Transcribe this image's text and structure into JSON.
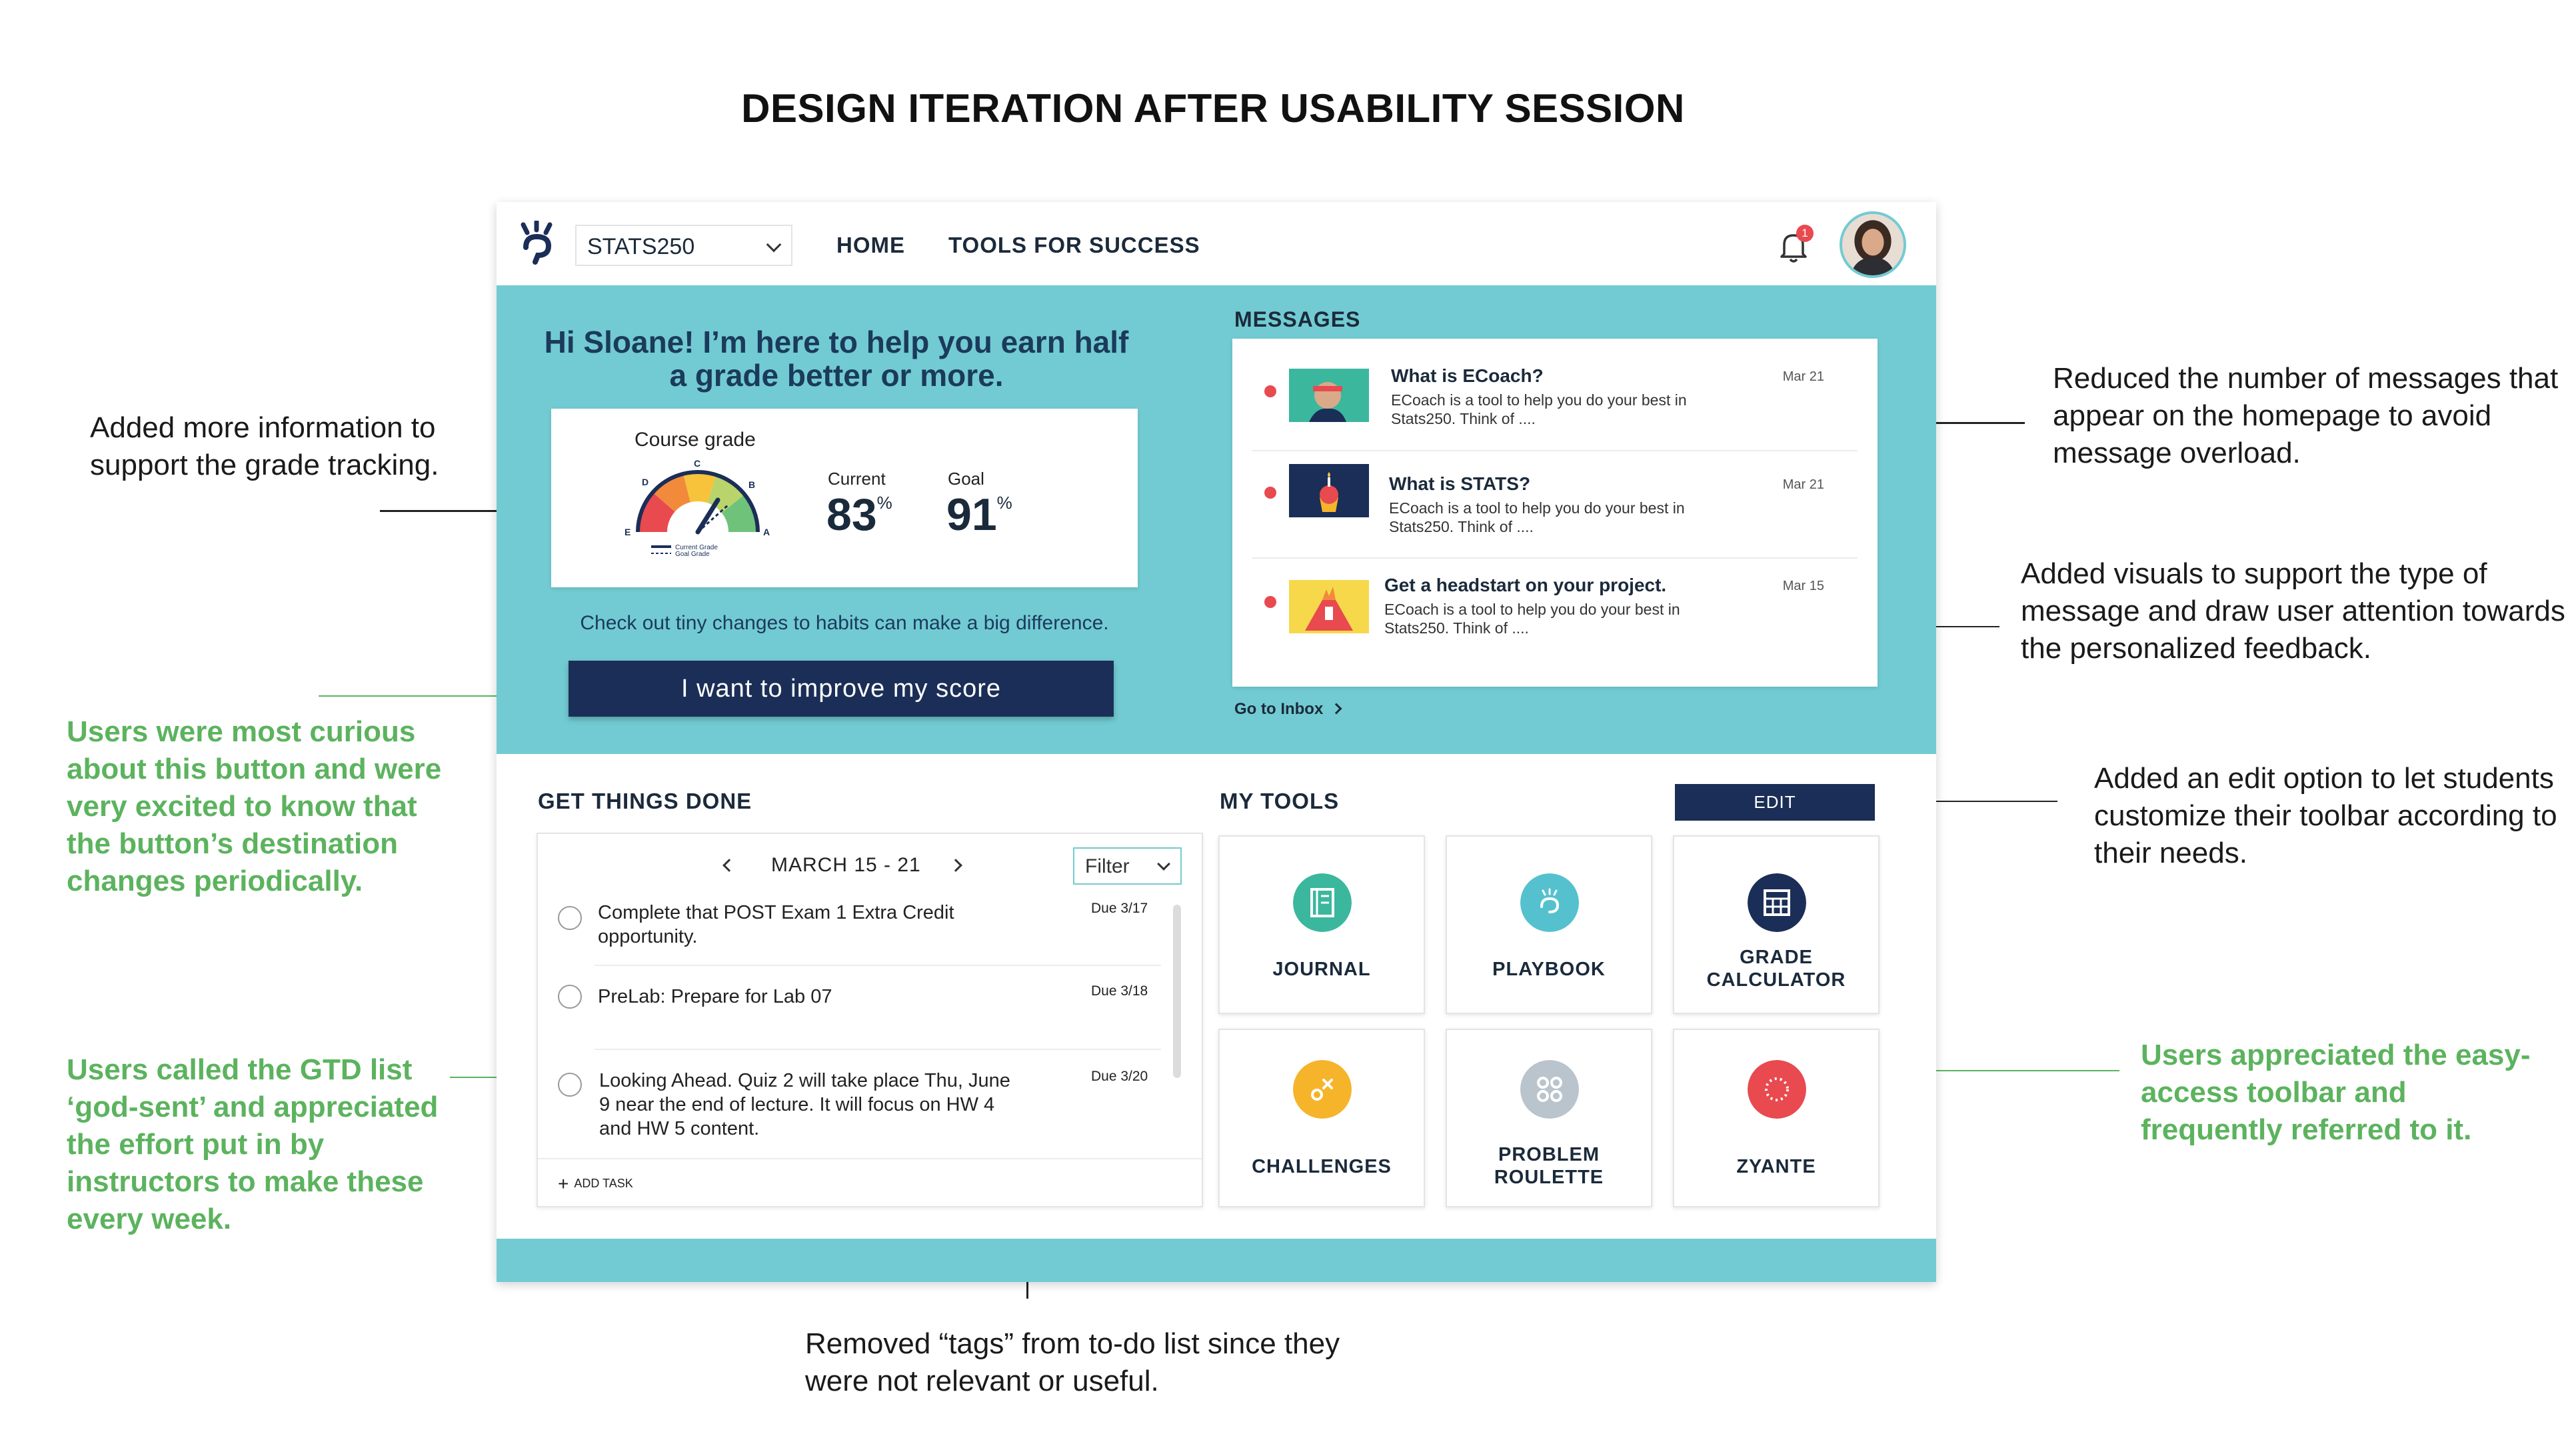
{
  "page_title": "DESIGN ITERATION AFTER USABILITY SESSION",
  "annotations": {
    "grade_tracking": "Added more information to support the grade tracking.",
    "button_curious": "Users were most curious about this button and were very excited to know that the button’s destination changes periodically.",
    "gtd_godsent": "Users called the GTD list ‘god-sent’ and appreciated the effort put in by instructors to make these every week.",
    "removed_tags": "Removed “tags” from to-do list since they were not relevant or useful.",
    "reduced_messages": "Reduced the number of messages that appear on the homepage to avoid message overload.",
    "added_visuals": "Added visuals to support the type of message and draw user attention towards the personalized feedback.",
    "edit_option": "Added an edit option to let students customize their toolbar according to their needs.",
    "toolbar_appreciated": "Users appreciated the easy-access toolbar and frequently referred to it."
  },
  "colors": {
    "teal": "#72cbd2",
    "navy": "#1b2e57",
    "annotation_green": "#5cb35e",
    "alert_red": "#e84a4f"
  },
  "topbar": {
    "course": "STATS250",
    "nav": [
      "HOME",
      "TOOLS FOR SUCCESS"
    ],
    "notification_count": "1",
    "logo_icon": "ecoach-logo-icon",
    "bell_icon": "bell-icon"
  },
  "hero": {
    "greeting": "Hi Sloane! I’m here to help you earn half a grade better or more.",
    "grade_card": {
      "title": "Course grade",
      "current_label": "Current",
      "current_value": "83",
      "goal_label": "Goal",
      "goal_value": "91",
      "unit": "%",
      "gauge_letters": [
        "E",
        "D",
        "C",
        "B",
        "A"
      ],
      "legend_current": "Current Grade",
      "legend_goal": "Goal Grade"
    },
    "habits_text": "Check out tiny changes to habits can make a big difference.",
    "improve_button": "I want to improve my score"
  },
  "messages": {
    "title": "MESSAGES",
    "items": [
      {
        "title": "What is ECoach?",
        "body": "ECoach is a tool to help you do your best in Stats250. Think of ....",
        "date": "Mar 21"
      },
      {
        "title": "What is STATS?",
        "body": "ECoach is a tool to help you do your best in Stats250. Think of ....",
        "date": "Mar 21"
      },
      {
        "title": "Get a headstart on your project.",
        "body": "ECoach is a tool to help you do your best in Stats250. Think of ....",
        "date": "Mar 15"
      }
    ],
    "inbox_link": "Go to Inbox"
  },
  "gtd": {
    "title": "GET THINGS DONE",
    "week": "MARCH 15 - 21",
    "filter": "Filter",
    "tasks": [
      {
        "text": "Complete that POST Exam 1 Extra Credit opportunity.",
        "due": "Due 3/17"
      },
      {
        "text": "PreLab: Prepare for Lab 07",
        "due": "Due 3/18"
      },
      {
        "text": "Looking Ahead. Quiz 2 will take place Thu, June 9 near the end of lecture. It will focus on HW 4 and HW 5 content.",
        "due": "Due 3/20"
      }
    ],
    "add_task": "ADD TASK"
  },
  "tools": {
    "title": "MY TOOLS",
    "edit": "EDIT",
    "items": [
      {
        "label": "JOURNAL",
        "color": "#3bb79e",
        "icon": "journal-icon"
      },
      {
        "label": "PLAYBOOK",
        "color": "#55c1cf",
        "icon": "playbook-icon"
      },
      {
        "label": "GRADE CALCULATOR",
        "color": "#1b2e57",
        "icon": "calculator-icon"
      },
      {
        "label": "CHALLENGES",
        "color": "#f6b42a",
        "icon": "challenges-icon"
      },
      {
        "label": "PROBLEM ROULETTE",
        "color": "#b9c4cc",
        "icon": "roulette-icon"
      },
      {
        "label": "ZYANTE",
        "color": "#e84a4f",
        "icon": "zyante-icon"
      }
    ]
  }
}
